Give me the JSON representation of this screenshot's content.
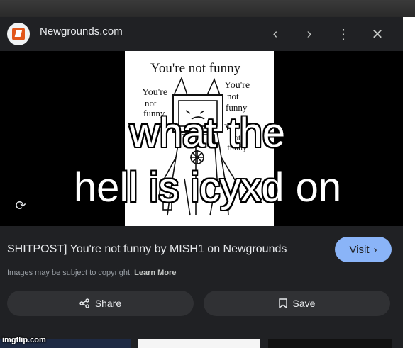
{
  "header": {
    "site_name": "Newgrounds.com",
    "icons": [
      "back-icon",
      "forward-icon",
      "more-icon",
      "close-icon"
    ]
  },
  "drawing_text": {
    "title": "You're not funny",
    "left": [
      "You're",
      "not",
      "funny"
    ],
    "right": [
      "You're",
      "not",
      "funny"
    ],
    "right2": [
      "You're",
      "not",
      "funny"
    ]
  },
  "result": {
    "title": "SHITPOST] You're not funny by MISH1 on Newgrounds",
    "visit_label": "Visit",
    "copyright": "Images may be subject to copyright.",
    "learn_more": "Learn More",
    "share_label": "Share",
    "save_label": "Save"
  },
  "meme": {
    "line1": "what the",
    "line2": "hell is icyxd on"
  },
  "watermark": "imgflip.com",
  "colors": {
    "panel": "#202124",
    "visit": "#8ab4f8",
    "button": "#303134",
    "text": "#e8eaed"
  }
}
